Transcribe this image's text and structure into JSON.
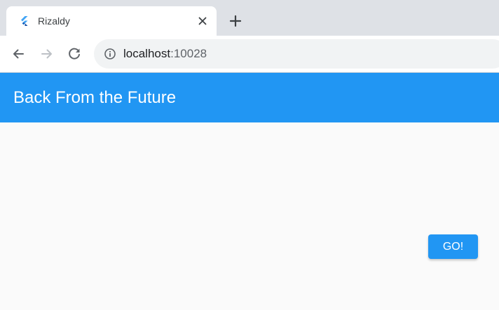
{
  "browser": {
    "tab": {
      "title": "Rizaldy",
      "favicon": "flutter-logo-icon",
      "close_icon": "close-icon"
    },
    "new_tab_icon": "plus-icon",
    "nav": {
      "back_icon": "back-arrow-icon",
      "forward_icon": "forward-arrow-icon",
      "reload_icon": "reload-icon"
    },
    "address_bar": {
      "info_icon": "info-icon",
      "host": "localhost",
      "port": ":10028"
    }
  },
  "app": {
    "title": "Back From the Future",
    "primary_color": "#2196f3",
    "background_color": "#fafafa",
    "go_button_label": "GO!"
  }
}
